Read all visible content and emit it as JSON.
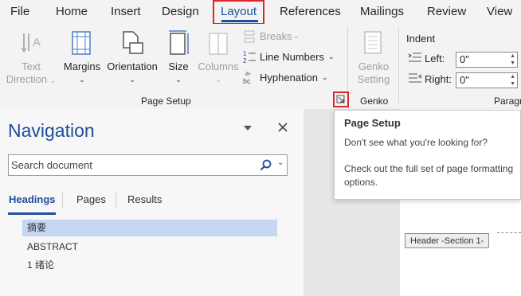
{
  "tabs": [
    "File",
    "Home",
    "Insert",
    "Design",
    "Layout",
    "References",
    "Mailings",
    "Review",
    "View"
  ],
  "ribbon": {
    "text_direction": [
      "Text",
      "Direction"
    ],
    "margins": "Margins",
    "orientation": "Orientation",
    "size": "Size",
    "columns": "Columns",
    "breaks": "Breaks",
    "line_numbers": "Line Numbers",
    "hyphenation": "Hyphenation",
    "page_setup_group": "Page Setup",
    "genko_setting": [
      "Genko",
      "Setting"
    ],
    "genko_group": "Genko",
    "indent_title": "Indent",
    "indent_left_label": "Left:",
    "indent_left_value": "0\"",
    "indent_right_label": "Right:",
    "indent_right_value": "0\"",
    "paragraph_group_partial": "Paragr"
  },
  "navigation": {
    "title": "Navigation",
    "search_placeholder": "Search document",
    "tabs": [
      "Headings",
      "Pages",
      "Results"
    ],
    "headings": [
      "摘要",
      "ABSTRACT",
      "1 绪论"
    ]
  },
  "document": {
    "header_tag": "Header -Section 1-"
  },
  "tooltip": {
    "title": "Page Setup",
    "line1": "Don't see what you're looking for?",
    "line2": "Check out the full set of page formatting options."
  },
  "colors": {
    "accent": "#1f4e9c",
    "highlight_box": "#e0242a",
    "selected_heading": "#c5d7f2"
  }
}
